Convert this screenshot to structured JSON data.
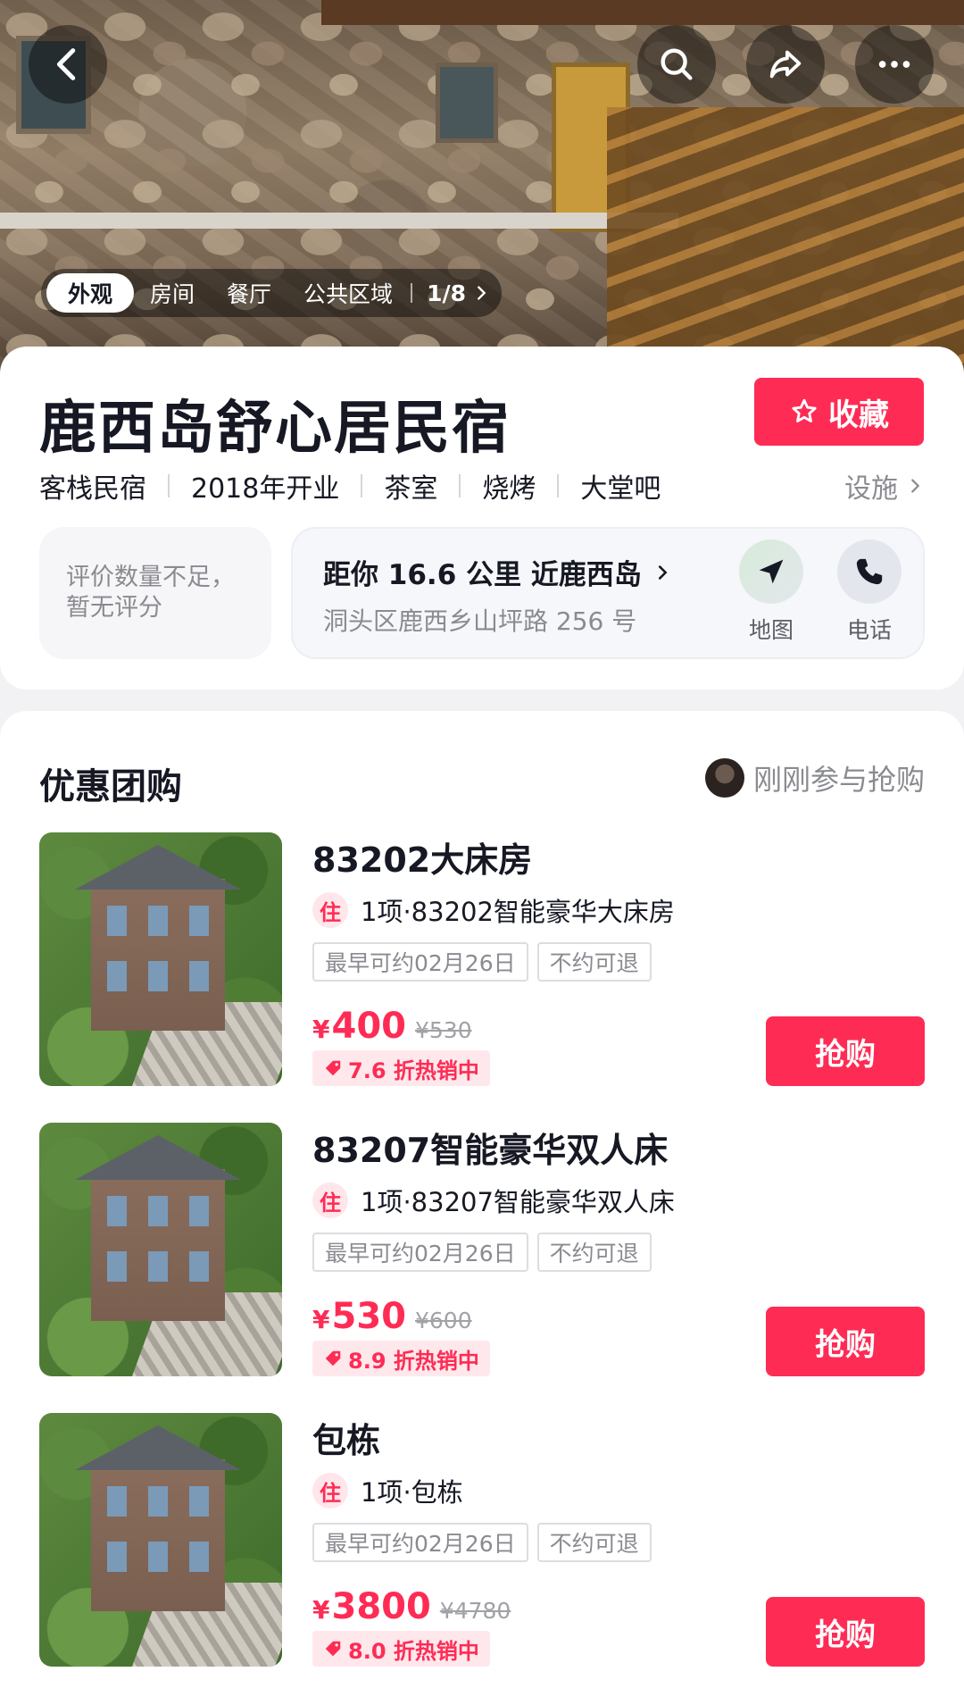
{
  "hero": {
    "image_tabs": [
      {
        "label": "外观",
        "active": true
      },
      {
        "label": "房间",
        "active": false
      },
      {
        "label": "餐厅",
        "active": false
      },
      {
        "label": "公共区域",
        "active": false
      }
    ],
    "image_counter": "1/8",
    "icons": [
      "back-icon",
      "search-icon",
      "share-icon",
      "more-icon"
    ]
  },
  "hotel": {
    "name": "鹿西岛舒心居民宿",
    "favorite_label": "收藏",
    "tags": [
      "客栈民宿",
      "2018年开业",
      "茶室",
      "烧烤",
      "大堂吧"
    ],
    "facilities_label": "设施",
    "rating_text": "评价数量不足，暂无评分",
    "distance": "距你 16.6 公里 近鹿西岛",
    "address": "洞头区鹿西乡山坪路 256 号",
    "map_label": "地图",
    "phone_label": "电话"
  },
  "deals": {
    "title": "优惠团购",
    "join_text": "刚刚参与抢购",
    "buy_label": "抢购",
    "items": [
      {
        "name": "83202大床房",
        "item_badge": "住",
        "item_desc": "1项·83202智能豪华大床房",
        "chip_date": "最早可约02月26日",
        "chip_refund": "不约可退",
        "currency": "¥",
        "price": "400",
        "original_price": "¥530",
        "discount": "7.6 折热销中"
      },
      {
        "name": "83207智能豪华双人床",
        "item_badge": "住",
        "item_desc": "1项·83207智能豪华双人床",
        "chip_date": "最早可约02月26日",
        "chip_refund": "不约可退",
        "currency": "¥",
        "price": "530",
        "original_price": "¥600",
        "discount": "8.9 折热销中"
      },
      {
        "name": "包栋",
        "item_badge": "住",
        "item_desc": "1项·包栋",
        "chip_date": "最早可约02月26日",
        "chip_refund": "不约可退",
        "currency": "¥",
        "price": "3800",
        "original_price": "¥4780",
        "discount": "8.0 折热销中"
      }
    ]
  },
  "colors": {
    "accent": "#fe2c55",
    "text_primary": "#161823",
    "text_secondary": "#8a8b91"
  }
}
